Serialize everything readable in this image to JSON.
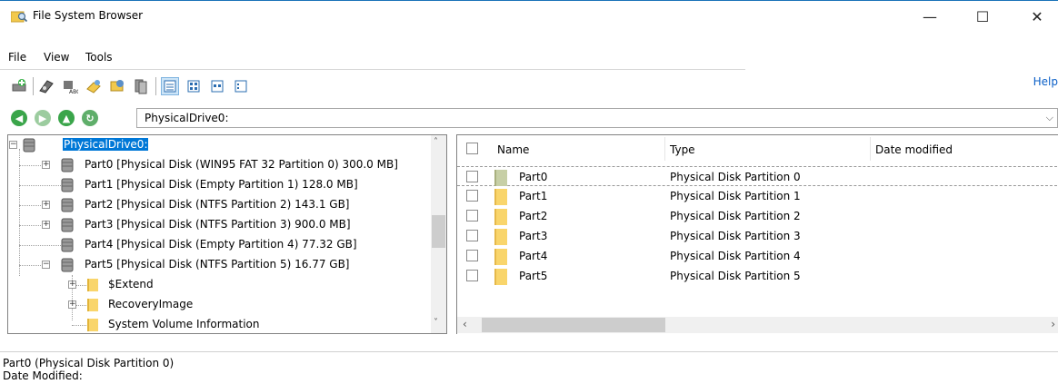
{
  "window": {
    "title": "File System Browser",
    "minimize": "—",
    "maximize": "☐",
    "close": "✕"
  },
  "menu": {
    "items": [
      "File",
      "View",
      "Tools"
    ]
  },
  "toolbar": {
    "buttons": [
      "add-drive-icon",
      "scan-icon",
      "find-icon",
      "recover-icon",
      "properties-icon",
      "copy-icon"
    ],
    "views": [
      "details-view-icon",
      "large-icons-view-icon",
      "small-icons-view-icon",
      "list-view-icon"
    ],
    "help_label": "Help"
  },
  "nav": {
    "path": "PhysicalDrive0:",
    "dropdown": "⌵"
  },
  "tree": {
    "root": "PhysicalDrive0:",
    "nodes": [
      {
        "label": "Part0 [Physical Disk (WIN95 FAT 32 Partition 0) 300.0 MB]",
        "expandable": true
      },
      {
        "label": "Part1 [Physical Disk (Empty Partition 1) 128.0 MB]",
        "expandable": false
      },
      {
        "label": "Part2 [Physical Disk (NTFS Partition 2) 143.1 GB]",
        "expandable": true
      },
      {
        "label": "Part3 [Physical Disk (NTFS Partition 3) 900.0 MB]",
        "expandable": true
      },
      {
        "label": "Part4 [Physical Disk (Empty Partition 4) 77.32 GB]",
        "expandable": false
      },
      {
        "label": "Part5 [Physical Disk (NTFS Partition 5) 16.77 GB]",
        "expandable": true,
        "expanded": true
      }
    ],
    "children": [
      {
        "label": "$Extend",
        "expandable": true
      },
      {
        "label": "RecoveryImage",
        "expandable": true
      },
      {
        "label": "System Volume Information",
        "expandable": false
      }
    ]
  },
  "list": {
    "columns": [
      "Name",
      "Type",
      "Date modified"
    ],
    "rows": [
      {
        "name": "Part0",
        "type": "Physical Disk Partition 0"
      },
      {
        "name": "Part1",
        "type": "Physical Disk Partition 1"
      },
      {
        "name": "Part2",
        "type": "Physical Disk Partition 2"
      },
      {
        "name": "Part3",
        "type": "Physical Disk Partition 3"
      },
      {
        "name": "Part4",
        "type": "Physical Disk Partition 4"
      },
      {
        "name": "Part5",
        "type": "Physical Disk Partition 5"
      }
    ]
  },
  "status": {
    "line1": "Part0 (Physical Disk Partition 0)",
    "line2": "Date Modified:"
  },
  "colors": {
    "selection": "#0078d7",
    "folder": "#f9d56b",
    "help_link": "#0a5fc7"
  }
}
